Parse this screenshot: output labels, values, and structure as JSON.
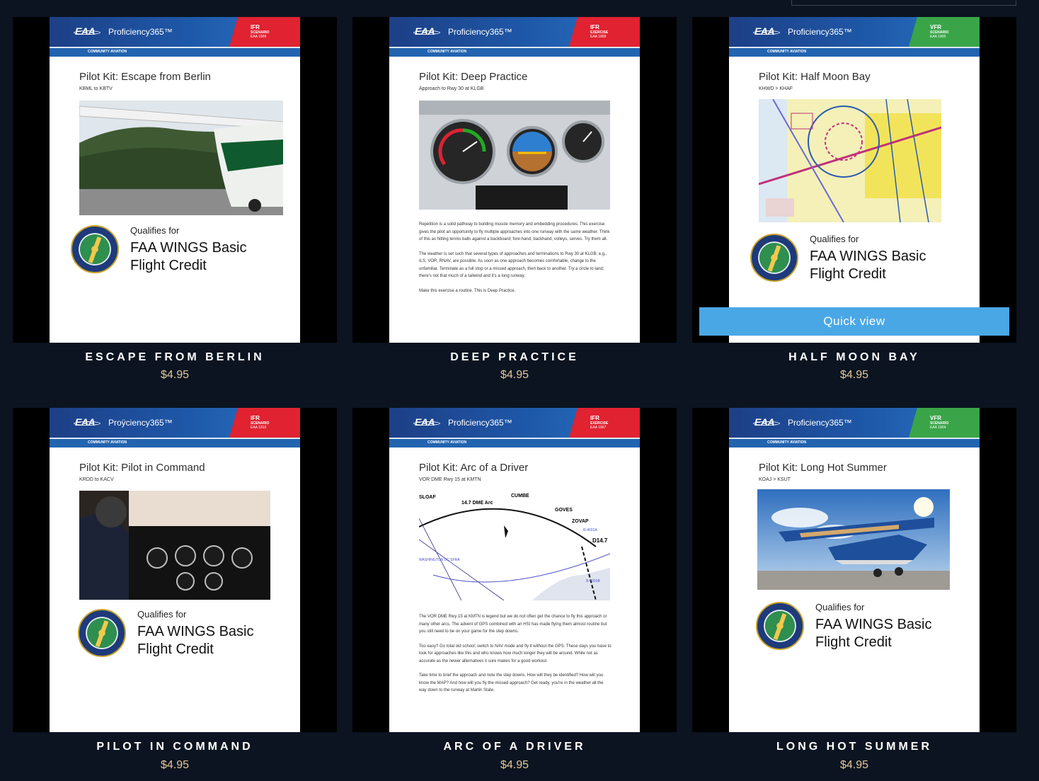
{
  "brand": {
    "logo": "EAA",
    "name": "Proficiency365™",
    "stripe": "COMMUNITY AVIATION"
  },
  "qualifies": {
    "line1": "Qualifies for",
    "line2": "FAA WINGS Basic",
    "line3": "Flight Credit"
  },
  "quick_view_label": "Quick view",
  "products": [
    {
      "tag_type": "IFR",
      "tag_sub": "SCENARIO",
      "tag_code": "EAA 1909",
      "tag_color": "ifr",
      "kit_title": "Pilot Kit: Escape from Berlin",
      "kit_route": "KBML to KBTV",
      "name": "ESCAPE FROM BERLIN",
      "price": "$4.95"
    },
    {
      "tag_type": "IFR",
      "tag_sub": "EXERCISE",
      "tag_code": "EAA 1908",
      "tag_color": "ifr",
      "kit_title": "Pilot Kit: Deep Practice",
      "kit_route": "Approach to Rwy 30 at KLGB",
      "body": [
        "Repetition is a solid pathway to building muscle memory and embedding procedures. This exercise gives the pilot an opportunity to fly multiple approaches into one runway with the same weather. Think of this as hitting tennis balls against a backboard; fore-hand, backhand, volleys, serves. Try them all.",
        "The weather is set such that several types of approaches and terminations to Rwy 30 at KLGB; e.g., ILS, VOR, RNAV, are possible. As soon as one approach becomes comfortable, change to the unfamiliar. Terminate as a full stop or a missed approach, then back to another. Try a circle to land; there's not that much of a tailwind and it's a long runway.",
        "Make this exercise a routine. This is Deep Practice."
      ],
      "name": "DEEP PRACTICE",
      "price": "$4.95"
    },
    {
      "tag_type": "VFR",
      "tag_sub": "SCENARIO",
      "tag_code": "EAA 1905",
      "tag_color": "vfr",
      "kit_title": "Pilot Kit: Half Moon Bay",
      "kit_route": "KHWD > KHAF",
      "name": "HALF MOON BAY",
      "price": "$4.95"
    },
    {
      "tag_type": "IFR",
      "tag_sub": "SCENARIO",
      "tag_code": "EAA 1910",
      "tag_color": "ifr",
      "kit_title": "Pilot Kit: Pilot in Command",
      "kit_route": "KRDD to KACV",
      "brand_alt": "Proÿciency365™",
      "name": "PILOT IN COMMAND",
      "price": "$4.95"
    },
    {
      "tag_type": "IFR",
      "tag_sub": "EXERCISE",
      "tag_code": "EAA 1907",
      "tag_color": "ifr",
      "kit_title": "Pilot Kit: Arc of a Driver",
      "kit_route": "VOR DME Rwy 15 at KMTN",
      "chart_labels": [
        "SLOAF",
        "14.7 DME Arc",
        "CUMBE",
        "GOVES",
        "ZOVAP",
        "D14.7",
        "WASHINGTON DC SFRA",
        "R-4001A",
        "R-4001B"
      ],
      "body": [
        "The VOR DME Rwy 15 at KMTN is legend but we do not often get the chance to fly this approach or many other arcs. The advent of GPS combined with an HSI has made flying them almost routine but you still need to be on your game for the step downs.",
        "Too easy? Go total old school; switch to NAV mode and fly it without the GPS. These days you have to look for approaches like this and who knows how much longer they will be around. While not as accurate as the newer alternatives it sure makes for a good workout.",
        "Take time to brief the approach and note the step downs. How will they be identified? How will you know the MAP? And how will you fly the missed approach? Get ready, you're in the weather all the way down to the runway at Martin State."
      ],
      "name": "ARC OF A DRIVER",
      "price": "$4.95"
    },
    {
      "tag_type": "VFR",
      "tag_sub": "SCENARIO",
      "tag_code": "EAA 1904",
      "tag_color": "vfr",
      "kit_title": "Pilot Kit: Long Hot Summer",
      "kit_route": "KOAJ > KSUT",
      "name": "LONG HOT SUMMER",
      "price": "$4.95"
    }
  ],
  "colors": {
    "background": "#0b1420",
    "price": "#e6c79a",
    "ifr_tag": "#e02231",
    "vfr_tag": "#3aa548",
    "quick_view": "#4aa7e6"
  }
}
